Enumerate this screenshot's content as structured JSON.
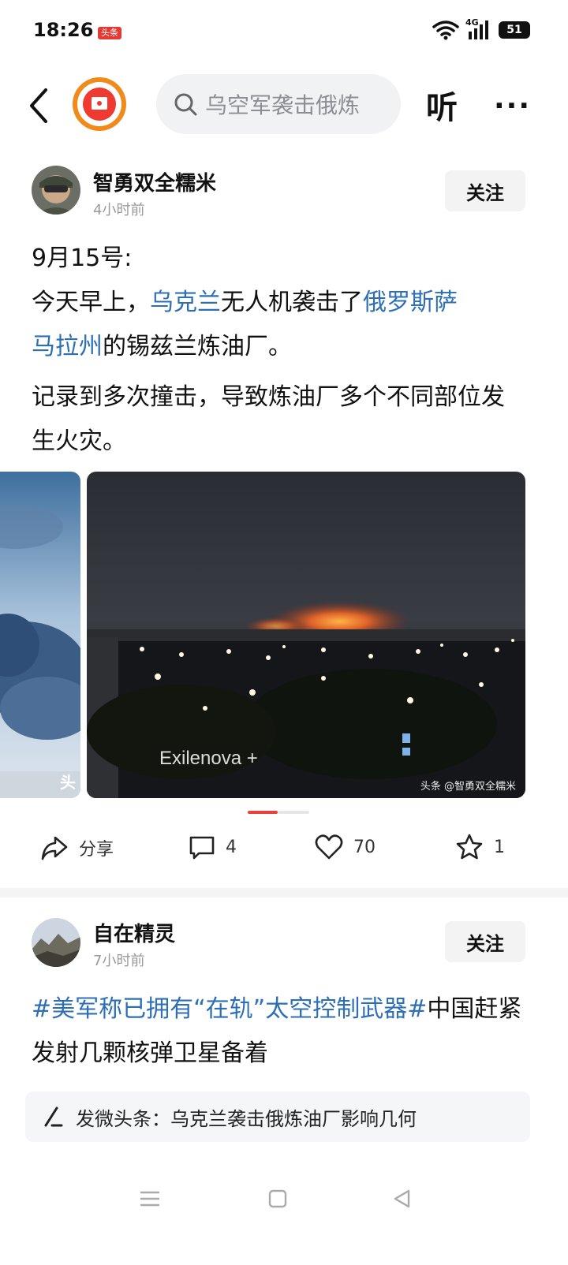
{
  "status_bar": {
    "time": "18:26",
    "app_badge": "头条",
    "network": "4G",
    "battery": "51"
  },
  "top_nav": {
    "search_placeholder": "乌空军袭击俄炼",
    "listen_label": "听",
    "more_label": "···"
  },
  "post1": {
    "author": "智勇双全糯米",
    "time": "4小时前",
    "follow_label": "关注",
    "line1": "9月15号:",
    "line2_pre": "今天早上，",
    "line2_link1": "乌克兰",
    "line2_mid": "无人机袭击了",
    "line2_link2": "俄罗斯萨",
    "line3_link": "马拉州",
    "line3_post": "的锡兹兰炼油厂。",
    "para2": "记录到多次撞击，导致炼油厂多个不同部位发生火灾。",
    "image_watermark": "Exilenova +",
    "image_source": "头条 @智勇双全糯米",
    "left_image_label": "头"
  },
  "actions": {
    "share_label": "分享",
    "comment_count": "4",
    "like_count": "70",
    "favorite_count": "1"
  },
  "post2": {
    "author": "自在精灵",
    "time": "7小时前",
    "follow_label": "关注",
    "hashtag": "#美军称已拥有“在轨”太空控制武器#",
    "text_rest": "中国赶紧发射几颗核弹卫星备着"
  },
  "banner": {
    "text": "发微头条：乌克兰袭击俄炼油厂影响几何"
  },
  "colors": {
    "link": "#2d6fb7",
    "accent": "#e8423a",
    "logo_orange": "#f08a1a"
  }
}
